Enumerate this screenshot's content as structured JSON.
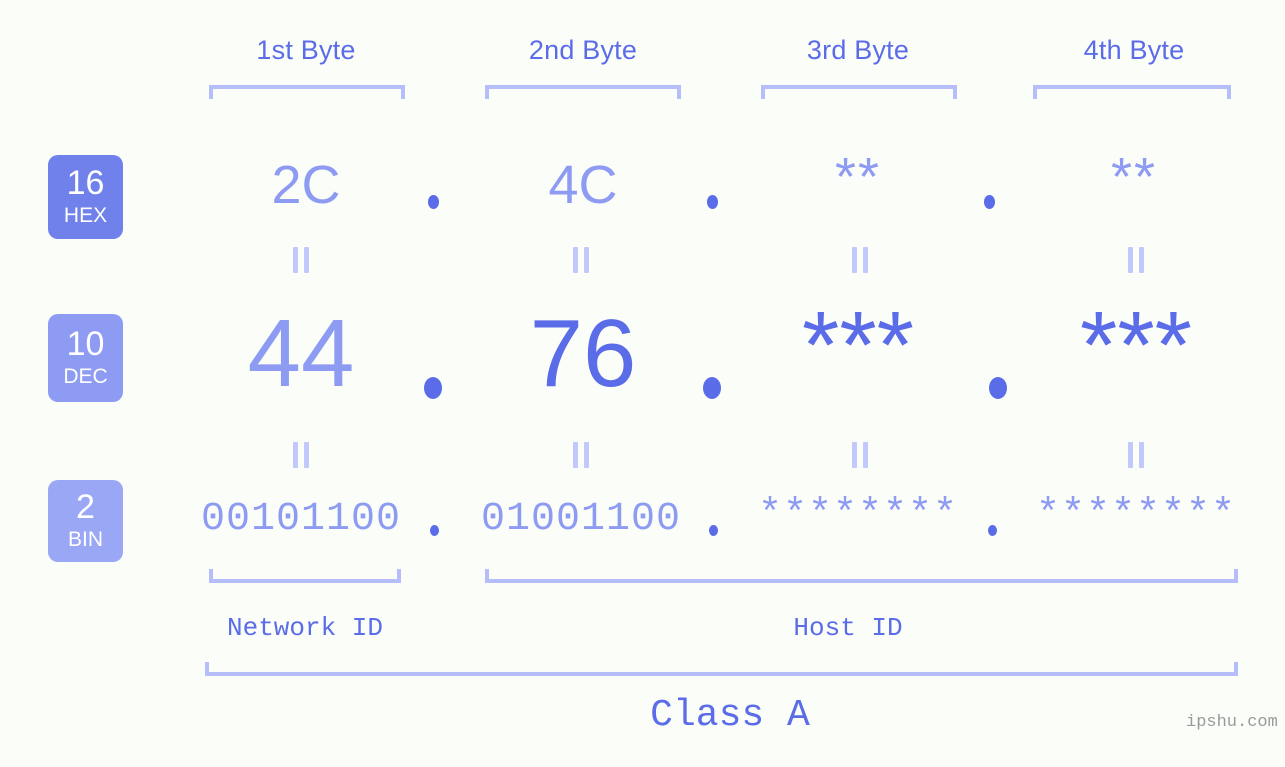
{
  "meta": {
    "background_color": "#fbfdf8",
    "accent_strong": "#5b6ce8",
    "accent_mid": "#8e9bf2",
    "accent_light": "#b6bdfb",
    "badge_text_color": "#ffffff"
  },
  "byte_headers": [
    {
      "label": "1st Byte"
    },
    {
      "label": "2nd Byte"
    },
    {
      "label": "3rd Byte"
    },
    {
      "label": "4th Byte"
    }
  ],
  "base_badges": [
    {
      "number": "16",
      "abbr": "HEX",
      "color": "#7181ec"
    },
    {
      "number": "10",
      "abbr": "DEC",
      "color": "#8e9bf2"
    },
    {
      "number": "2",
      "abbr": "BIN",
      "color": "#9aa7f5"
    }
  ],
  "rows": {
    "hex": {
      "base_number": "16",
      "base_abbr": "HEX",
      "values": [
        "2C",
        "4C",
        "**",
        "**"
      ],
      "separator": "."
    },
    "dec": {
      "base_number": "10",
      "base_abbr": "DEC",
      "values": [
        "44",
        "76",
        "***",
        "***"
      ],
      "separator": "."
    },
    "bin": {
      "base_number": "2",
      "base_abbr": "BIN",
      "values": [
        "00101100",
        "01001100",
        "********",
        "********"
      ],
      "separator": "."
    }
  },
  "equals_marks": {
    "symbol": "=",
    "count_per_row_gap": 4
  },
  "sections": [
    {
      "label": "Network ID"
    },
    {
      "label": "Host ID"
    }
  ],
  "class_label": "Class A",
  "watermark": "ipshu.com"
}
